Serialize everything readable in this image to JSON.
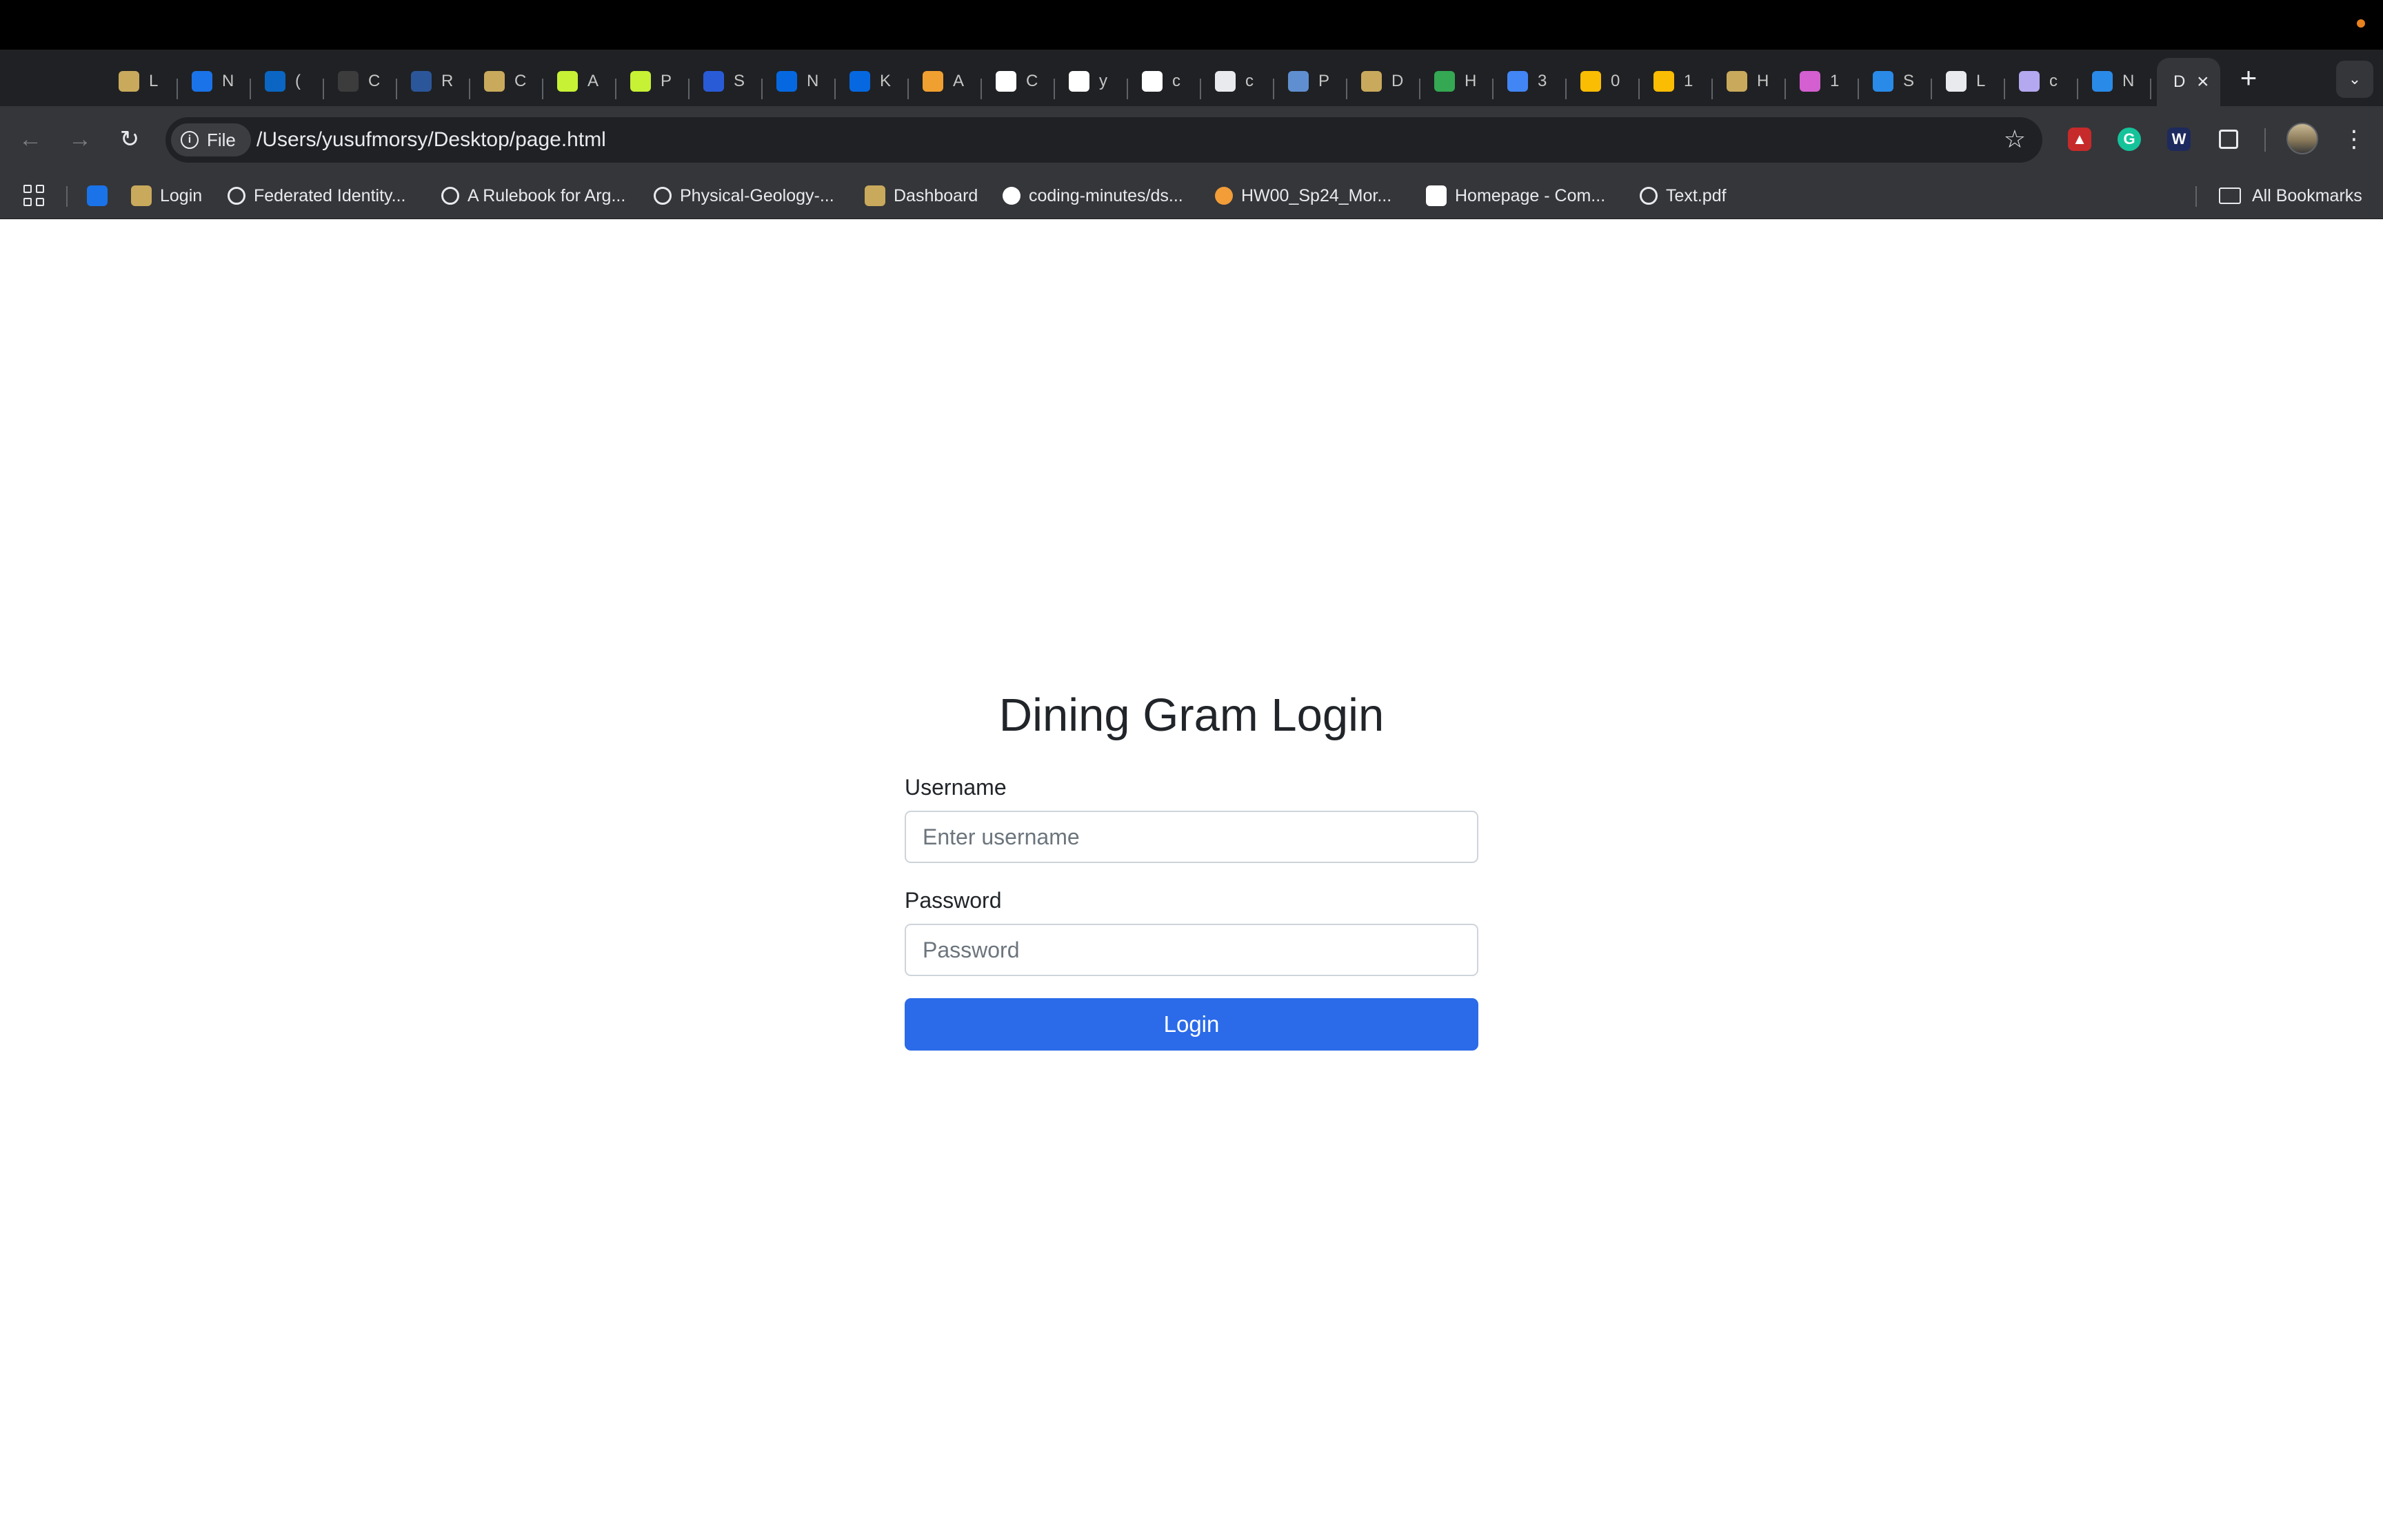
{
  "browser": {
    "tabs": [
      {
        "title": "L",
        "icon": "cu-buffalo-icon",
        "color": "#c9a95c"
      },
      {
        "title": "N",
        "icon": "outlook-icon",
        "color": "#1a73e8"
      },
      {
        "title": "(",
        "icon": "linkedin-icon",
        "color": "#0a66c2"
      },
      {
        "title": "C",
        "icon": "openai-icon",
        "color": "#3c3c3c"
      },
      {
        "title": "R",
        "icon": "word-icon",
        "color": "#2b579a"
      },
      {
        "title": "C",
        "icon": "cu-buffalo-icon",
        "color": "#c9a95c"
      },
      {
        "title": "A",
        "icon": "hypothesis-icon",
        "color": "#c6f135"
      },
      {
        "title": "P",
        "icon": "hypothesis-icon",
        "color": "#c6f135"
      },
      {
        "title": "S",
        "icon": "c-logo-icon",
        "color": "#2a5bd7"
      },
      {
        "title": "N",
        "icon": "meta-icon",
        "color": "#0668e1"
      },
      {
        "title": "K",
        "icon": "meta-icon",
        "color": "#0668e1"
      },
      {
        "title": "A",
        "icon": "amplify-icon",
        "color": "#f0a030"
      },
      {
        "title": "C",
        "icon": "github-icon",
        "color": "#ffffff"
      },
      {
        "title": "y",
        "icon": "github-icon",
        "color": "#ffffff"
      },
      {
        "title": "c",
        "icon": "github-icon",
        "color": "#ffffff"
      },
      {
        "title": "c",
        "icon": "robot-icon",
        "color": "#e8eaed"
      },
      {
        "title": "P",
        "icon": "document-icon",
        "color": "#5f8fd0"
      },
      {
        "title": "D",
        "icon": "cu-buffalo-icon",
        "color": "#c9a95c"
      },
      {
        "title": "H",
        "icon": "google-drive-icon",
        "color": "#34a853"
      },
      {
        "title": "3",
        "icon": "google-docs-icon",
        "color": "#4285f4"
      },
      {
        "title": "0",
        "icon": "google-slides-icon",
        "color": "#fbbc04"
      },
      {
        "title": "1",
        "icon": "google-slides-icon",
        "color": "#fbbc04"
      },
      {
        "title": "H",
        "icon": "cu-buffalo-icon",
        "color": "#c9a95c"
      },
      {
        "title": "1",
        "icon": "feather-icon",
        "color": "#d35fd0"
      },
      {
        "title": "S",
        "icon": "vscode-icon",
        "color": "#2a8ae8"
      },
      {
        "title": "L",
        "icon": "notes-icon",
        "color": "#e8eaed"
      },
      {
        "title": "c",
        "icon": "copilot-icon",
        "color": "#b4a8f0"
      },
      {
        "title": "N",
        "icon": "vscode-icon",
        "color": "#2a8ae8"
      }
    ],
    "active_tab": {
      "title": "D",
      "close_icon": "close-icon"
    },
    "new_tab_icon": "plus-icon",
    "tab_search_icon": "chevron-down-icon",
    "address": {
      "chip_label": "File",
      "url": "/Users/yusufmorsy/Desktop/page.html"
    },
    "bookmarks": [
      {
        "label": "",
        "icon": "outlook-icon",
        "color": "#1a73e8"
      },
      {
        "label": "Login",
        "icon": "cu-buffalo-icon",
        "color": "#c9a95c"
      },
      {
        "label": "Federated Identity...",
        "icon": "globe-icon",
        "color": "#e8eaed"
      },
      {
        "label": "A Rulebook for Arg...",
        "icon": "globe-icon",
        "color": "#e8eaed"
      },
      {
        "label": "Physical-Geology-...",
        "icon": "globe-icon",
        "color": "#e8eaed"
      },
      {
        "label": "Dashboard",
        "icon": "cu-buffalo-icon",
        "color": "#c9a95c"
      },
      {
        "label": "coding-minutes/ds...",
        "icon": "github-icon",
        "color": "#ffffff"
      },
      {
        "label": "HW00_Sp24_Mor...",
        "icon": "circle-icon",
        "color": "#f29d38"
      },
      {
        "label": "Homepage - Com...",
        "icon": "d2l-icon",
        "color": "#ffffff"
      },
      {
        "label": "Text.pdf",
        "icon": "globe-icon",
        "color": "#e8eaed"
      }
    ],
    "all_bookmarks_label": "All Bookmarks"
  },
  "login": {
    "title": "Dining Gram Login",
    "username_label": "Username",
    "username_placeholder": "Enter username",
    "username_value": "",
    "password_label": "Password",
    "password_placeholder": "Password",
    "password_value": "",
    "button_label": "Login",
    "button_color": "#2b6be9"
  }
}
